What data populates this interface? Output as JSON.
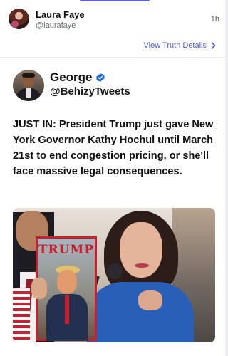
{
  "post": {
    "author_name": "Laura Faye",
    "author_handle": "@laurafaye",
    "timestamp": "1h",
    "view_details_label": "View Truth Details"
  },
  "embedded_tweet": {
    "name": "George",
    "handle": "@BehizyTweets",
    "verified": true,
    "text": "JUST IN: President Trump just gave New York Governor Kathy Hochul until March 21st to end congestion pricing, or she'll face massive legal consequences.",
    "photo": {
      "magazine_title": "TRUMP"
    }
  },
  "colors": {
    "accent": "#5c5cf0",
    "link": "#4e59d6",
    "verified": "#1d6bd8"
  }
}
